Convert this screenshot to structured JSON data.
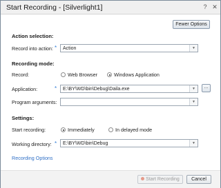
{
  "window": {
    "title": "Start Recording - [Silverlight1]",
    "help_glyph": "?",
    "close_glyph": "✕"
  },
  "toolbar": {
    "fewer_options_label": "Fewer Options"
  },
  "action_selection": {
    "heading": "Action selection:",
    "record_into_label": "Record into action:",
    "record_into_value": "Action"
  },
  "recording_mode": {
    "heading": "Recording mode:",
    "record_label": "Record:",
    "options": [
      "Web Browser",
      "Windows Application"
    ],
    "selected": "Windows Application",
    "application_label": "Application:",
    "application_value": "E:\\BY\\WD\\bin\\Debug\\Daila.exe",
    "browse_label": "...",
    "program_args_label": "Program arguments:",
    "program_args_value": ""
  },
  "settings": {
    "heading": "Settings:",
    "start_recording_label": "Start recording:",
    "start_options": [
      "Immediately",
      "In delayed mode"
    ],
    "start_selected": "Immediately",
    "working_dir_label": "Working directory:",
    "working_dir_value": "E:\\BY\\WD\\bin\\Debug"
  },
  "links": {
    "recording_options": "Recording Options"
  },
  "footer": {
    "start_label": "Start Recording",
    "cancel_label": "Cancel"
  },
  "required_marker": "*",
  "colors": {
    "accent": "#2f6fc6",
    "required": "#2f7bd6"
  },
  "icons": {
    "dropdown": "chevron-down-icon",
    "record": "record-dot-icon"
  }
}
